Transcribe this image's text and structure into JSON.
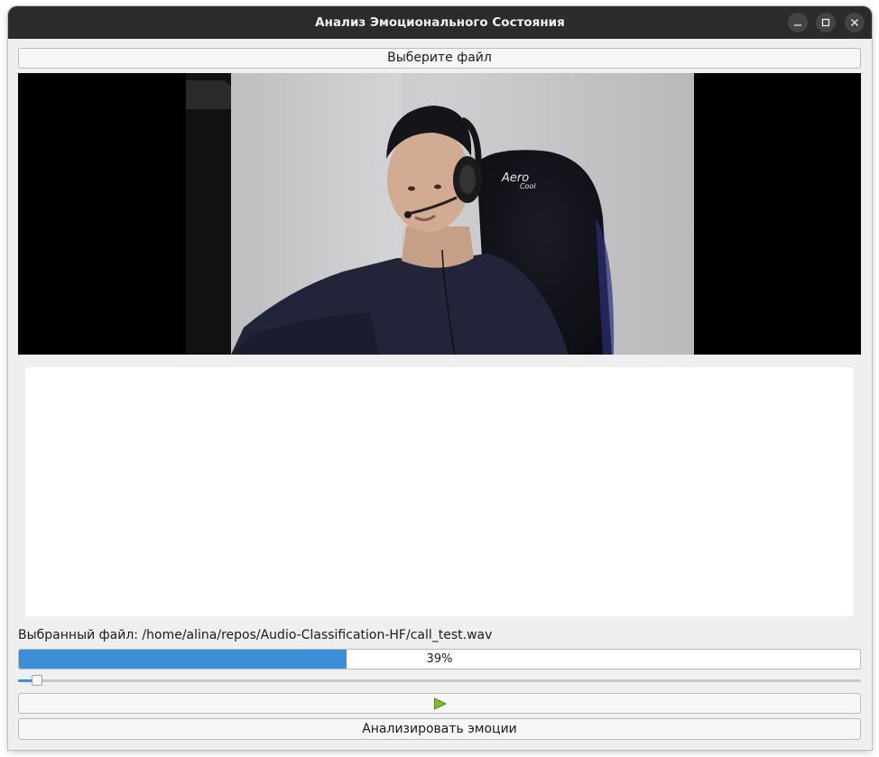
{
  "window": {
    "title": "Анализ Эмоционального Состояния",
    "controls": [
      "minimize-icon",
      "maximize-icon",
      "close-icon"
    ]
  },
  "file_button": {
    "label": "Выберите файл"
  },
  "video": {
    "description_icon": "video-frame"
  },
  "selected_file": {
    "text": "Выбранный файл: /home/alina/repos/Audio-Classification-HF/call_test.wav"
  },
  "progress": {
    "value": 39,
    "label": "39%"
  },
  "playback_slider": {
    "position": 0.012
  },
  "play_button": {
    "icon": "play-icon",
    "color": "#7bbf2a"
  },
  "analyze_button": {
    "label": "Анализировать эмоции"
  },
  "colors": {
    "titlebar": "#2b2b2b",
    "window_bg": "#efefef",
    "progress_fill": "#3a8fd8",
    "play_icon": "#7bbf2a"
  }
}
